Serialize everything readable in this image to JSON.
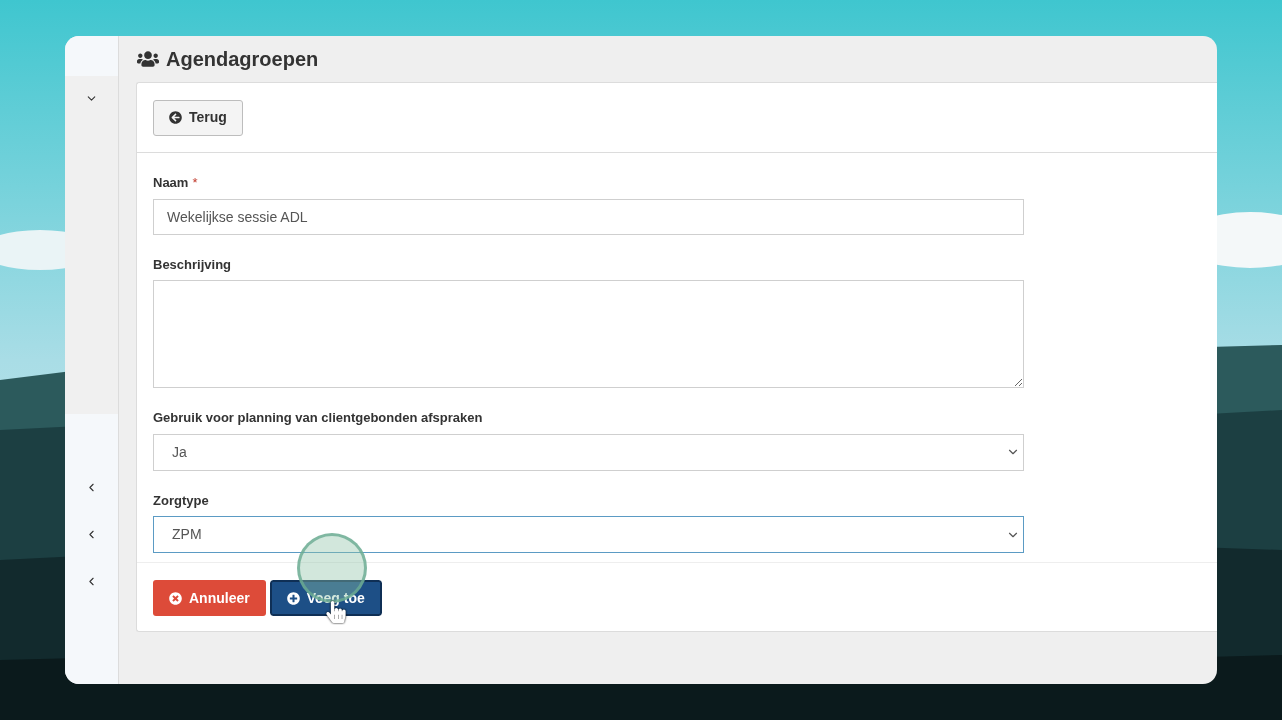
{
  "sidebar": {
    "items": [
      {
        "expanded": true
      },
      {
        "expanded": false
      },
      {
        "expanded": false
      },
      {
        "expanded": false
      }
    ]
  },
  "page": {
    "title": "Agendagroepen"
  },
  "back_button": {
    "label": "Terug"
  },
  "form": {
    "fields": [
      {
        "kind": "text",
        "label": "Naam",
        "required_mark": "*",
        "value": "Wekelijkse sessie ADL",
        "focused": false
      },
      {
        "kind": "textarea",
        "label": "Beschrijving",
        "focused": false
      },
      {
        "kind": "select",
        "label": "Gebruik voor planning van clientgebonden afspraken",
        "value": "Ja",
        "focused": false
      },
      {
        "kind": "select",
        "label": "Zorgtype",
        "value": "ZPM",
        "focused": true
      }
    ]
  },
  "buttons": [
    {
      "kind": "cancel",
      "label": "Annuleer"
    },
    {
      "kind": "submit",
      "label": "Voeg toe"
    }
  ]
}
